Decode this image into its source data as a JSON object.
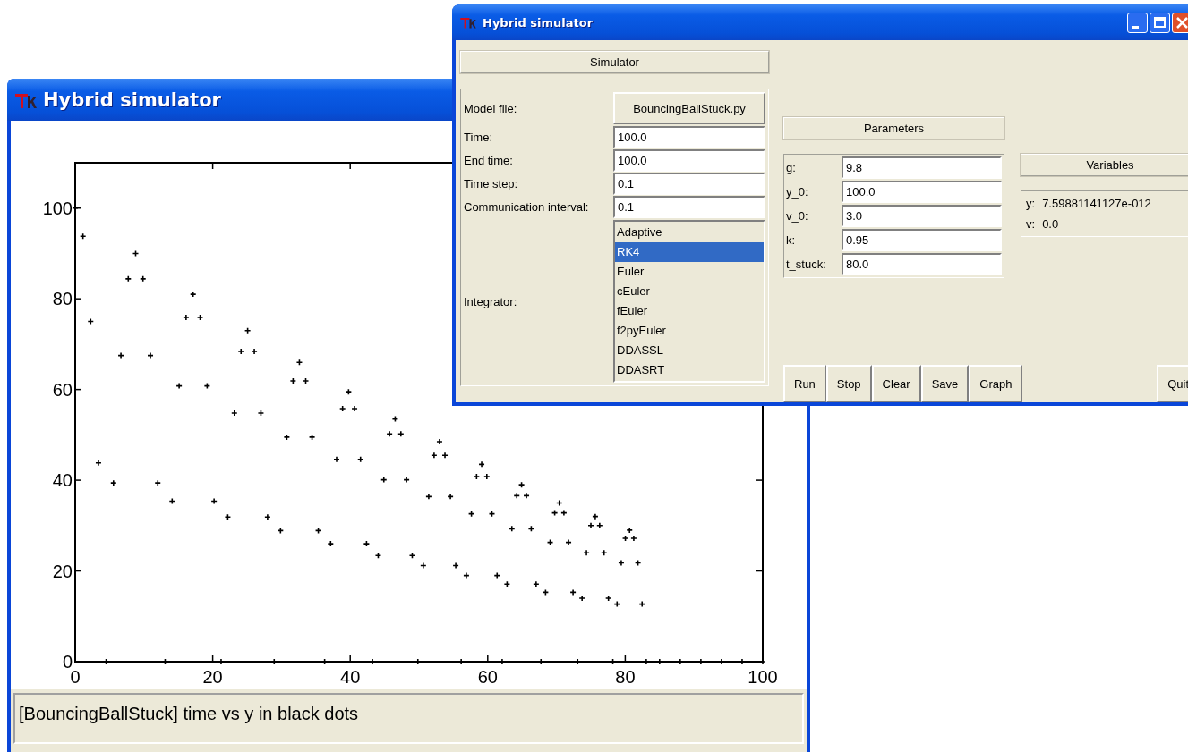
{
  "plot_window": {
    "title": "Hybrid simulator",
    "chart_data": {
      "type": "scatter",
      "xlim": [
        0,
        100
      ],
      "ylim": [
        0,
        110
      ],
      "xticks": [
        0,
        20,
        40,
        60,
        80,
        100
      ],
      "yticks": [
        0,
        20,
        40,
        60,
        80,
        100
      ],
      "x": [
        0,
        1.13,
        2.25,
        3.38,
        4.5,
        5.57,
        6.65,
        7.72,
        8.79,
        9.86,
        10.94,
        12.01,
        13.08,
        14.1,
        15.12,
        16.13,
        17.15,
        18.17,
        19.19,
        20.2,
        21.22,
        22.19,
        23.15,
        24.12,
        25.08,
        26.05,
        27.01,
        27.98,
        28.94,
        29.86,
        30.78,
        31.69,
        32.61,
        33.53,
        34.45,
        35.36,
        36.28,
        37.15,
        38.02,
        38.89,
        39.76,
        40.63,
        41.5,
        42.37,
        43.24,
        44.07,
        44.89,
        45.72,
        46.54,
        47.37,
        48.19,
        49.02,
        49.84,
        50.63,
        51.42,
        52.2,
        52.99,
        53.78,
        54.57,
        55.35,
        56.14,
        56.89,
        57.63,
        58.38,
        59.12,
        59.87,
        60.61,
        61.36,
        62.1,
        62.81,
        63.51,
        64.22,
        64.92,
        65.63,
        66.33,
        67.04,
        67.74,
        68.41,
        69.08,
        69.74,
        70.41,
        71.08,
        71.75,
        72.41,
        73.08,
        73.72,
        74.36,
        75,
        75.64,
        76.28,
        76.92,
        77.56,
        78.2,
        78.81,
        79.42,
        80.02,
        80.63,
        81.24,
        81.85,
        82.45,
        83.06,
        85,
        88,
        91,
        94,
        97,
        100
      ],
      "series": [
        {
          "color": "#000000",
          "values": [
            100,
            93.8,
            75,
            43.8,
            0,
            39.4,
            67.5,
            84.4,
            90,
            84.4,
            67.5,
            39.4,
            0,
            35.4,
            60.8,
            75.9,
            81,
            75.9,
            60.8,
            35.4,
            0,
            31.9,
            54.8,
            68.4,
            73,
            68.4,
            54.8,
            31.9,
            0,
            28.9,
            49.5,
            61.9,
            66,
            61.9,
            49.5,
            28.9,
            0,
            26,
            44.6,
            55.8,
            59.5,
            55.8,
            44.6,
            26,
            0,
            23.4,
            40.1,
            50.2,
            53.5,
            50.2,
            40.1,
            23.4,
            0,
            21.2,
            36.4,
            45.5,
            48.5,
            45.5,
            36.4,
            21.2,
            0,
            19,
            32.6,
            40.8,
            43.5,
            40.8,
            32.6,
            19,
            0,
            17.1,
            29.3,
            36.6,
            39,
            36.6,
            29.3,
            17.1,
            0,
            15.3,
            26.3,
            32.8,
            35,
            32.8,
            26.3,
            15.3,
            0,
            14,
            24,
            30,
            32,
            30,
            24,
            14,
            0,
            12.7,
            21.8,
            27.2,
            29,
            27.2,
            21.8,
            12.7,
            0,
            0,
            0,
            0,
            0,
            0,
            0
          ]
        }
      ]
    },
    "status_text": "[BouncingBallStuck] time vs y in black dots"
  },
  "simulator_window": {
    "title": "Hybrid simulator",
    "simulator_header": "Simulator",
    "model_file_label": "Model file:",
    "model_file_button": "BouncingBallStuck.py",
    "fields": [
      {
        "label": "Time:",
        "value": "100.0"
      },
      {
        "label": "End time:",
        "value": "100.0"
      },
      {
        "label": "Time step:",
        "value": "0.1"
      },
      {
        "label": "Communication interval:",
        "value": "0.1"
      }
    ],
    "integrator": {
      "label": "Integrator:",
      "options": [
        {
          "label": "Adaptive",
          "selected": false
        },
        {
          "label": "RK4",
          "selected": true
        },
        {
          "label": "Euler",
          "selected": false
        },
        {
          "label": "cEuler",
          "selected": false
        },
        {
          "label": "fEuler",
          "selected": false
        },
        {
          "label": "f2pyEuler",
          "selected": false
        },
        {
          "label": "DDASSL",
          "selected": false
        },
        {
          "label": "DDASRT",
          "selected": false
        }
      ]
    },
    "parameters_header": "Parameters",
    "parameters": [
      {
        "label": "g:",
        "value": "9.8"
      },
      {
        "label": "y_0:",
        "value": "100.0"
      },
      {
        "label": "v_0:",
        "value": "3.0"
      },
      {
        "label": "k:",
        "value": "0.95"
      },
      {
        "label": "t_stuck:",
        "value": "80.0"
      }
    ],
    "variables_header": "Variables",
    "variables": [
      {
        "label": "y:",
        "value": "7.59881141127e-012"
      },
      {
        "label": "v:",
        "value": "0.0"
      }
    ],
    "buttons": [
      "Run",
      "Stop",
      "Clear",
      "Save",
      "Graph"
    ],
    "quit_button": "Quit"
  }
}
